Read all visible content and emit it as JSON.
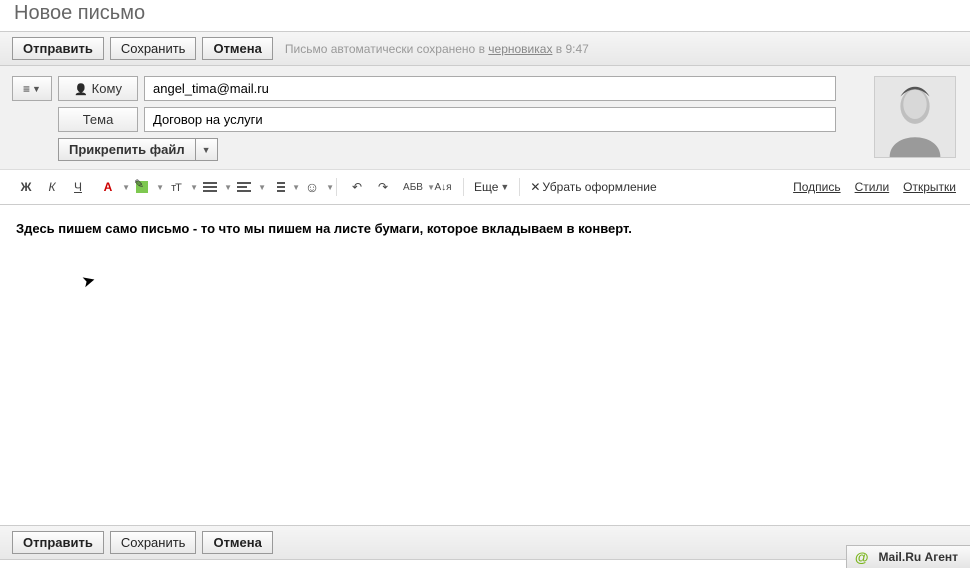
{
  "title": "Новое письмо",
  "toolbar": {
    "send": "Отправить",
    "save": "Сохранить",
    "cancel": "Отмена",
    "autosave_prefix": "Письмо автоматически сохранено в ",
    "autosave_drafts": "черновиках",
    "autosave_time": " в 9:47"
  },
  "compose": {
    "options_glyph": "≡",
    "to_label": "Кому",
    "to_value": "angel_tima@mail.ru",
    "subject_label": "Тема",
    "subject_value": "Договор на услуги",
    "attach_label": "Прикрепить файл"
  },
  "format": {
    "bold": "Ж",
    "italic": "К",
    "underline": "Ч",
    "color": "А",
    "spell": "АБВ",
    "sort": "А↓я",
    "more": "Еще",
    "remove_format": "Убрать оформление",
    "signature": "Подпись",
    "styles": "Стили",
    "cards": "Открытки"
  },
  "body_text": "Здесь пишем само письмо - то что мы пишем на листе бумаги, которое вкладываем в конверт.",
  "agent": {
    "label": "Mail.Ru Агент",
    "icon": "@"
  }
}
